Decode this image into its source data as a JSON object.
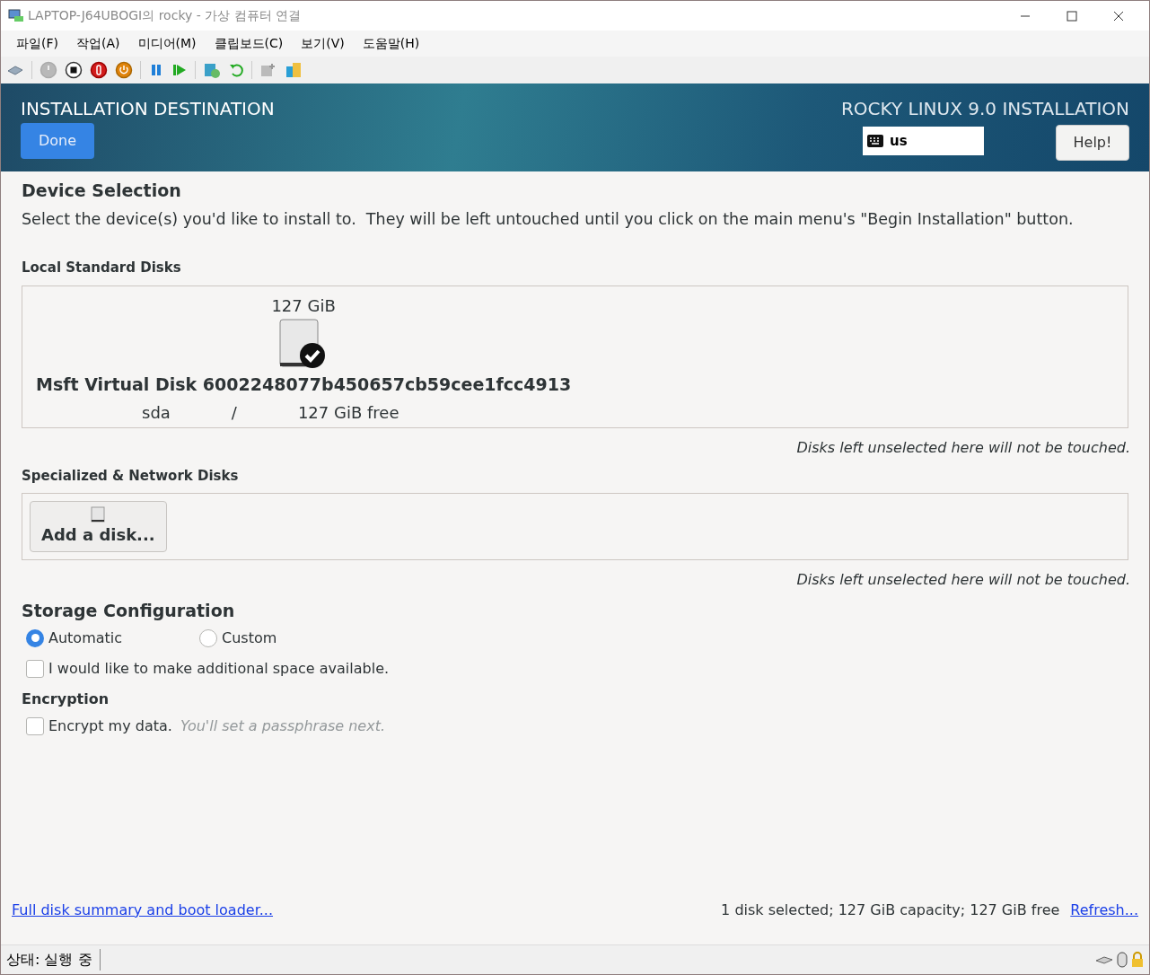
{
  "window": {
    "title": "LAPTOP-J64UBOGI의 rocky - 가상 컴퓨터 연결"
  },
  "menu": [
    "파일(F)",
    "작업(A)",
    "미디어(M)",
    "클립보드(C)",
    "보기(V)",
    "도움말(H)"
  ],
  "header": {
    "title": "INSTALLATION DESTINATION",
    "product": "ROCKY LINUX 9.0 INSTALLATION",
    "keyboard": "us",
    "done": "Done",
    "help": "Help!"
  },
  "device_selection": {
    "heading": "Device Selection",
    "description": "Select the device(s) you'd like to install to.  They will be left untouched until you click on the main menu's \"Begin Installation\" button."
  },
  "local_disks": {
    "heading": "Local Standard Disks",
    "disks": [
      {
        "size": "127 GiB",
        "name": "Msft Virtual Disk 6002248077b450657cb59cee1fcc4913",
        "device": "sda",
        "separator": "/",
        "free": "127 GiB free",
        "selected": true
      }
    ],
    "note": "Disks left unselected here will not be touched."
  },
  "specialized": {
    "heading": "Specialized & Network Disks",
    "add_button": "Add a disk...",
    "note": "Disks left unselected here will not be touched."
  },
  "storage": {
    "heading": "Storage Configuration",
    "options": [
      {
        "label": "Automatic",
        "selected": true
      },
      {
        "label": "Custom",
        "selected": false
      }
    ],
    "additional_space": {
      "label": "I would like to make additional space available.",
      "checked": false
    }
  },
  "encryption": {
    "heading": "Encryption",
    "encrypt": {
      "label": "Encrypt my data.",
      "hint": "You'll set a passphrase next.",
      "checked": false
    }
  },
  "footer": {
    "summary_link": "Full disk summary and boot loader...",
    "status": "1 disk selected; 127 GiB capacity; 127 GiB free",
    "refresh_link": "Refresh..."
  },
  "status_bar": {
    "text": "상태: 실행 중"
  }
}
